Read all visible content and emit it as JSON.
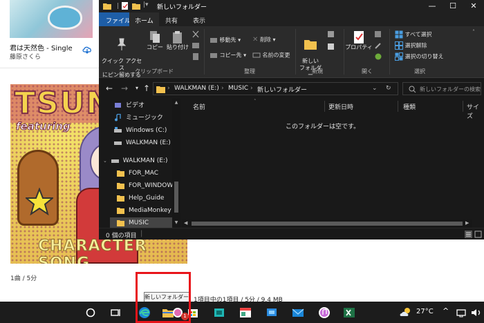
{
  "music_app": {
    "song_title": "君は天然色 - Single",
    "song_artist": "藤原さくら",
    "album_cover_text": "TSUN",
    "album_cover_featuring": "featuring",
    "album_cover_bottom": "CHARACTER SONG",
    "track_info": "1曲 / 5分",
    "selection_status": "1項目中の1項目 / 5分 / 9.4 MB"
  },
  "explorer": {
    "window_title": "新しいフォルダー",
    "tabs": [
      "ファイル",
      "ホーム",
      "共有",
      "表示"
    ],
    "ribbon": {
      "clipboard": {
        "pin_label": "クイック アクセス\nにピン留めする",
        "copy_label": "コピー",
        "paste_label": "貼り付け",
        "group": "クリップボード"
      },
      "organize": {
        "move_to": "移動先",
        "copy_to": "コピー先",
        "delete": "削除",
        "rename": "名前の変更",
        "group": "整理"
      },
      "new": {
        "new_folder": "新しい\nフォルダー",
        "group": "新規"
      },
      "open": {
        "properties": "プロパティ",
        "group": "開く"
      },
      "select": {
        "select_all": "すべて選択",
        "select_none": "選択解除",
        "invert": "選択の切り替え",
        "group": "選択"
      }
    },
    "address": {
      "drive": "WALKMAN (E:)",
      "folder": "MUSIC",
      "current": "新しいフォルダー"
    },
    "search_placeholder": "新しいフォルダーの検索",
    "nav_items": [
      "ビデオ",
      "ミュージック",
      "Windows (C:)",
      "WALKMAN (E:)",
      "WALKMAN (E:)",
      "FOR_MAC",
      "FOR_WINDOWS",
      "Help_Guide",
      "MediaMonkey",
      "MUSIC"
    ],
    "columns": [
      "名前",
      "更新日時",
      "種類",
      "サイズ"
    ],
    "empty_message": "このフォルダーは空です。",
    "status": "0 個の項目"
  },
  "tooltip": "新しいフォルダー",
  "taskbar": {
    "temperature": "27°C",
    "badge_count": "1"
  },
  "colors": {
    "file_tab": "#1e5ea7",
    "folder": "#f2c14e",
    "highlight_box": "#e8141a",
    "taskbar": "#1c1c1c"
  }
}
